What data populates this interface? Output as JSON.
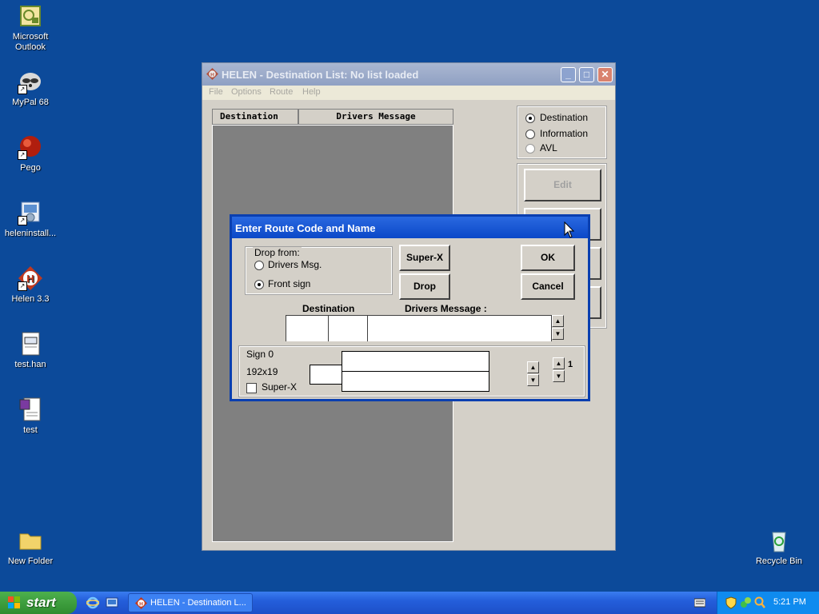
{
  "desktop": {
    "icons": [
      {
        "label": "Microsoft\nOutlook"
      },
      {
        "label": "MyPal 68"
      },
      {
        "label": "Pego"
      },
      {
        "label": "heleninstall..."
      },
      {
        "label": "Helen 3.3"
      },
      {
        "label": "test.han"
      },
      {
        "label": "test"
      },
      {
        "label": "New Folder"
      },
      {
        "label": "Recycle Bin"
      }
    ]
  },
  "main_window": {
    "title": "HELEN - Destination List: No list loaded",
    "menu": [
      "File",
      "Options",
      "Route",
      "Help"
    ],
    "columns": [
      "Destination",
      "Drivers Message"
    ],
    "view_options": [
      {
        "label": "Destination",
        "selected": true,
        "enabled": true
      },
      {
        "label": "Information",
        "selected": false,
        "enabled": true
      },
      {
        "label": "AVL",
        "selected": false,
        "enabled": false
      }
    ],
    "edit_button": "Edit"
  },
  "dialog": {
    "title": "Enter Route Code and Name",
    "drop_from_label": "Drop from:",
    "drop_options": [
      {
        "label": "Drivers Msg.",
        "selected": false
      },
      {
        "label": "Front sign",
        "selected": true
      }
    ],
    "superx_button": "Super-X",
    "drop_button": "Drop",
    "ok_button": "OK",
    "cancel_button": "Cancel",
    "destination_label": "Destination",
    "drivers_message_label": "Drivers Message :",
    "sign_label": "Sign 0",
    "sign_size": "192x19",
    "superx_checkbox": "Super-X",
    "superx_checked": false,
    "sign_counter": "1"
  },
  "taskbar": {
    "start_label": "start",
    "task_item": "HELEN - Destination L...",
    "clock": "5:21 PM"
  },
  "colors": {
    "desktop": "#0c4a9a",
    "dialog_title": "#0b48c8",
    "taskbar": "#245edb",
    "start_button": "#2f8c2f"
  }
}
